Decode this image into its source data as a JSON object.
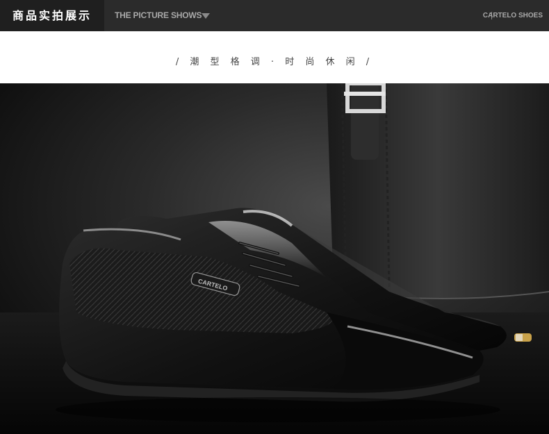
{
  "header": {
    "title_cn": "商品实拍展示",
    "title_en": "THE PICTURE SHOWS",
    "brand": "CARTELO SHOES",
    "dropdown_icon": "chevron-down-icon"
  },
  "tagline": "/ 潮 型 格 调 · 时 尚 休 闲 /",
  "photo": {
    "subject": "black patent leather lace-up dress shoes on dark background with leather bag",
    "logo_text": "CARTELO"
  },
  "colors": {
    "header_bg": "#2b2b2b",
    "header_title_bg": "#1f1f1f",
    "header_text": "#a9a9a9",
    "page_bg": "#ffffff"
  }
}
